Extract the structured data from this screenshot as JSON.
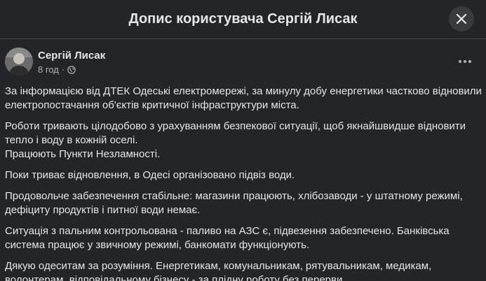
{
  "header": {
    "title": "Допис користувача Сергій Лисак",
    "close_icon": "close-icon"
  },
  "post": {
    "author": "Сергій Лисак",
    "time": "8 год",
    "separator": "·",
    "audience_icon": "globe-icon",
    "more_icon": "more-horizontal-icon",
    "paragraphs": [
      "За інформацією від ДТЕК Одеські електромережі, за минулу добу енергетики частково відновили електропостачання об'єктів критичної інфраструктури міста.",
      "Роботи тривають цілодобово з урахуванням безпекової ситуації, щоб якнайшвидше відновити тепло і воду в кожній оселі.\nПрацюють Пункти Незламності.",
      "Поки триває відновлення, в Одесі організовано підвіз води.",
      "Продовольче забезпечення стабільне: магазини працюють, хлібозаводи - у штатному режимі, дефіциту продуктів і питної води немає.",
      "Ситуація з пальним контрольована - паливо на АЗС є, підвезення забезпечено. Банківська система працює у звичному режимі, банкомати функціонують.",
      "Дякую одеситам за розуміння. Енергетикам, комунальникам, рятувальникам, медикам, волонтерам, відповідальному бізнесу - за плідну роботу без перерви."
    ]
  },
  "colors": {
    "background": "#242526",
    "text_primary": "#e4e6eb",
    "text_secondary": "#b0b3b8",
    "button_bg": "#3a3b3c",
    "divider": "#3e4042"
  }
}
